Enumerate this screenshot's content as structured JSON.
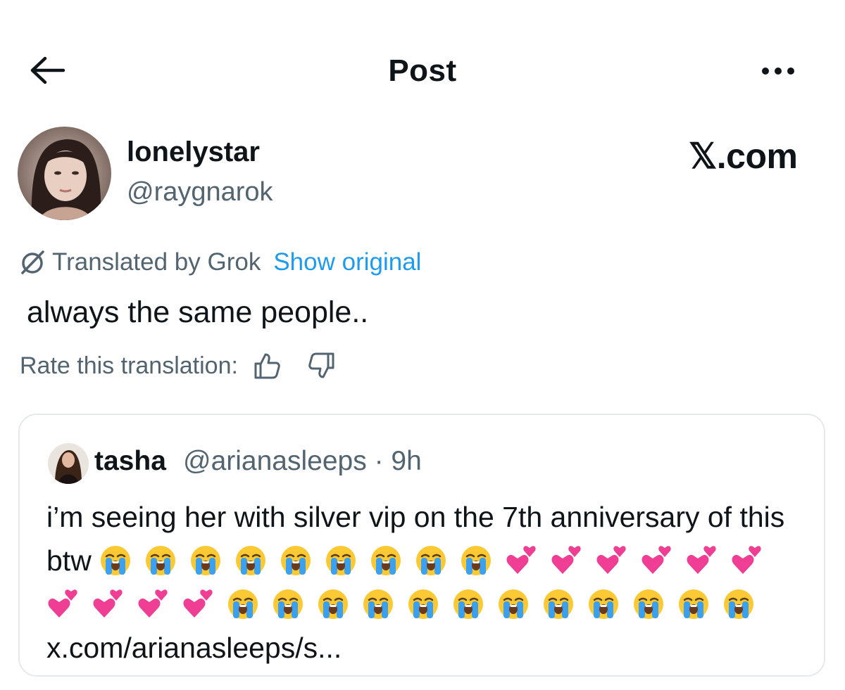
{
  "header": {
    "title": "Post"
  },
  "author": {
    "display_name": "lonelystar",
    "handle": "@raygnarok"
  },
  "watermark": "𝕏.com",
  "translation": {
    "label": "Translated by Grok",
    "show_original": "Show original",
    "text": "always the same people..",
    "rate_label": "Rate this translation:"
  },
  "quoted_post": {
    "name": "tasha",
    "handle_time": "@arianasleeps · 9h",
    "text": "i’m seeing her with silver vip on the 7th anniversary of this btw",
    "link": "x.com/arianasleeps/s...",
    "emojis": [
      "😭",
      "😭",
      "😭",
      "😭",
      "😭",
      "😭",
      "😭",
      "😭",
      "😭",
      "💕",
      "💕",
      "💕",
      "💕",
      "💕",
      "💕",
      "💕",
      "💕",
      "💕",
      "💕",
      "😭",
      "😭",
      "😭",
      "😭",
      "😭",
      "😭",
      "😭",
      "😭",
      "😭",
      "😭",
      "😭",
      "😭"
    ]
  },
  "colors": {
    "text": "#0f1419",
    "secondary": "#536471",
    "link": "#1d9bf0",
    "border": "#e6e9ec"
  }
}
